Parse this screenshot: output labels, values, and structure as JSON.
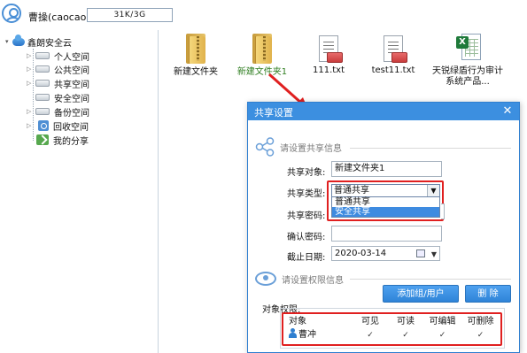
{
  "header": {
    "user_name": "曹操(caocao)",
    "quota": "31K/3G"
  },
  "tree": {
    "root_label": "鑫朗安全云",
    "items": [
      {
        "label": "个人空间"
      },
      {
        "label": "公共空间"
      },
      {
        "label": "共享空间"
      },
      {
        "label": "安全空间"
      },
      {
        "label": "备份空间"
      },
      {
        "label": "回收空间"
      },
      {
        "label": "我的分享"
      }
    ]
  },
  "files": [
    {
      "name": "新建文件夹",
      "type": "folder"
    },
    {
      "name": "新建文件夹1",
      "type": "folder"
    },
    {
      "name": "111.txt",
      "type": "txt"
    },
    {
      "name": "test11.txt",
      "type": "txt"
    },
    {
      "name": "天锐绿盾行为审计系统产品...",
      "type": "xls"
    }
  ],
  "colors": {
    "accent": "#3c8fe0",
    "highlight_text": "#2e7d1f",
    "annotation_red": "#e02020"
  },
  "dialog": {
    "title": "共享设置",
    "close_glyph": "✕",
    "share_info_title": "请设置共享信息",
    "labels": {
      "share_object": "共享对象:",
      "share_type": "共享类型:",
      "share_password": "共享密码:",
      "confirm_password": "确认密码:",
      "expire_date": "截止日期:"
    },
    "share_object_value": "新建文件夹1",
    "share_type_selected": "普通共享",
    "share_type_options": [
      "普通共享",
      "安全共享"
    ],
    "share_password_value": "",
    "confirm_password_value": "",
    "expire_date_value": "2020-03-14",
    "permission_title": "请设置权限信息",
    "add_group_user_button": "添加组/用户",
    "delete_button": "删 除",
    "object_permissions_label": "对象权限:",
    "permission_columns": [
      "对象",
      "可见",
      "可读",
      "可编辑",
      "可删除"
    ],
    "permission_rows": [
      {
        "object": "曹冲",
        "visible": "✓",
        "read": "✓",
        "edit": "✓",
        "delete": "✓"
      }
    ]
  }
}
